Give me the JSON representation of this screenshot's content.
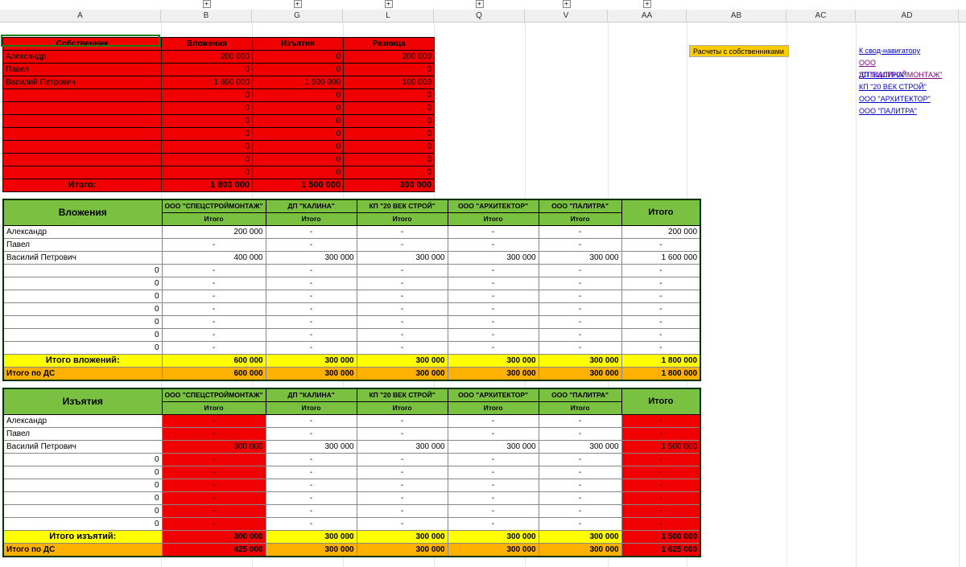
{
  "columns": [
    "A",
    "B",
    "G",
    "L",
    "Q",
    "V",
    "AA",
    "AB",
    "AC",
    "AD"
  ],
  "expand_positions": [
    "B",
    "G",
    "L",
    "Q",
    "V",
    "AA"
  ],
  "side": {
    "title": "Расчеты с собственниками",
    "links": [
      {
        "text": "К свод-навигатору",
        "color": "blue"
      },
      {
        "text": "ООО \"СПЕЦСТРОЙМОНТАЖ\"",
        "color": "purple"
      },
      {
        "text": "ДП \"КАЛИНА\"",
        "color": "blue"
      },
      {
        "text": "КП \"20 ВЕК СТРОЙ\"",
        "color": "blue"
      },
      {
        "text": "ООО \"АРХИТЕКТОР\"",
        "color": "blue"
      },
      {
        "text": "ООО \"ПАЛИТРА\"",
        "color": "blue"
      }
    ]
  },
  "red_table": {
    "headers": [
      "Собственник",
      "Вложения",
      "Изъятия",
      "Разница"
    ],
    "rows": [
      {
        "owner": "Александр",
        "inv": "200 000",
        "wd": "0",
        "diff": "200 000"
      },
      {
        "owner": "Павел",
        "inv": "0",
        "wd": "0",
        "diff": "0"
      },
      {
        "owner": "Василий Петрович",
        "inv": "1 600 000",
        "wd": "1 500 000",
        "diff": "100 000"
      },
      {
        "owner": "",
        "inv": "0",
        "wd": "0",
        "diff": "0"
      },
      {
        "owner": "",
        "inv": "0",
        "wd": "0",
        "diff": "0"
      },
      {
        "owner": "",
        "inv": "0",
        "wd": "0",
        "diff": "0"
      },
      {
        "owner": "",
        "inv": "0",
        "wd": "0",
        "diff": "0"
      },
      {
        "owner": "",
        "inv": "0",
        "wd": "0",
        "diff": "0"
      },
      {
        "owner": "",
        "inv": "0",
        "wd": "0",
        "diff": "0"
      },
      {
        "owner": "",
        "inv": "0",
        "wd": "0",
        "diff": "0"
      }
    ],
    "total": {
      "label": "Итого:",
      "inv": "1 800 000",
      "wd": "1 500 000",
      "diff": "300 000"
    }
  },
  "invest_table": {
    "title": "Вложения",
    "companies": [
      "ООО \"СПЕЦСТРОЙМОНТАЖ\"",
      "ДП \"КАЛИНА\"",
      "КП \"20 ВЕК СТРОЙ\"",
      "ООО \"АРХИТЕКТОР\"",
      "ООО \"ПАЛИТРА\""
    ],
    "subheader": "Итого",
    "total_col": "Итого",
    "rows": [
      {
        "owner": "Александр",
        "v": [
          "200 000",
          "-",
          "-",
          "-",
          "-"
        ],
        "total": "200 000"
      },
      {
        "owner": "Павел",
        "v": [
          "-",
          "-",
          "-",
          "-",
          "-"
        ],
        "total": "-"
      },
      {
        "owner": "Василий Петрович",
        "v": [
          "400 000",
          "300 000",
          "300 000",
          "300 000",
          "300 000"
        ],
        "total": "1 600 000"
      },
      {
        "owner": "0",
        "v": [
          "-",
          "-",
          "-",
          "-",
          "-"
        ],
        "total": "-"
      },
      {
        "owner": "0",
        "v": [
          "-",
          "-",
          "-",
          "-",
          "-"
        ],
        "total": "-"
      },
      {
        "owner": "0",
        "v": [
          "-",
          "-",
          "-",
          "-",
          "-"
        ],
        "total": "-"
      },
      {
        "owner": "0",
        "v": [
          "-",
          "-",
          "-",
          "-",
          "-"
        ],
        "total": "-"
      },
      {
        "owner": "0",
        "v": [
          "-",
          "-",
          "-",
          "-",
          "-"
        ],
        "total": "-"
      },
      {
        "owner": "0",
        "v": [
          "-",
          "-",
          "-",
          "-",
          "-"
        ],
        "total": "-"
      },
      {
        "owner": "0",
        "v": [
          "-",
          "-",
          "-",
          "-",
          "-"
        ],
        "total": "-"
      }
    ],
    "total_row": {
      "label": "Итого вложений:",
      "v": [
        "600 000",
        "300 000",
        "300 000",
        "300 000",
        "300 000"
      ],
      "total": "1 800 000"
    },
    "ds_row": {
      "label": "Итого по ДС",
      "v": [
        "600 000",
        "300 000",
        "300 000",
        "300 000",
        "300 000"
      ],
      "total": "1 800 000"
    }
  },
  "withdraw_table": {
    "title": "Изъятия",
    "companies": [
      "ООО \"СПЕЦСТРОЙМОНТАЖ\"",
      "ДП \"КАЛИНА\"",
      "КП \"20 ВЕК СТРОЙ\"",
      "ООО \"АРХИТЕКТОР\"",
      "ООО \"ПАЛИТРА\""
    ],
    "subheader": "Итого",
    "total_col": "Итого",
    "rows": [
      {
        "owner": "Александр",
        "v": [
          "-",
          "-",
          "-",
          "-",
          "-"
        ],
        "total": "-"
      },
      {
        "owner": "Павел",
        "v": [
          "-",
          "-",
          "-",
          "-",
          "-"
        ],
        "total": "-"
      },
      {
        "owner": "Василий Петрович",
        "v": [
          "300 000",
          "300 000",
          "300 000",
          "300 000",
          "300 000"
        ],
        "total": "1 500 000"
      },
      {
        "owner": "0",
        "v": [
          "-",
          "-",
          "-",
          "-",
          "-"
        ],
        "total": "-"
      },
      {
        "owner": "0",
        "v": [
          "-",
          "-",
          "-",
          "-",
          "-"
        ],
        "total": "-"
      },
      {
        "owner": "0",
        "v": [
          "-",
          "-",
          "-",
          "-",
          "-"
        ],
        "total": "-"
      },
      {
        "owner": "0",
        "v": [
          "-",
          "-",
          "-",
          "-",
          "-"
        ],
        "total": "-"
      },
      {
        "owner": "0",
        "v": [
          "-",
          "-",
          "-",
          "-",
          "-"
        ],
        "total": "-"
      },
      {
        "owner": "0",
        "v": [
          "-",
          "-",
          "-",
          "-",
          "-"
        ],
        "total": "-"
      }
    ],
    "total_row": {
      "label": "Итого изъятий:",
      "v": [
        "300 000",
        "300 000",
        "300 000",
        "300 000",
        "300 000"
      ],
      "total": "1 500 000"
    },
    "ds_row": {
      "label": "Итого по ДС",
      "v": [
        "425 000",
        "300 000",
        "300 000",
        "300 000",
        "300 000"
      ],
      "total": "1 625 000"
    }
  },
  "col_widths": {
    "A": 200,
    "B": 113,
    "G": 113,
    "L": 113,
    "Q": 113,
    "V": 103,
    "AA": 98,
    "AB": 124,
    "AC": 86,
    "AD": 128
  }
}
